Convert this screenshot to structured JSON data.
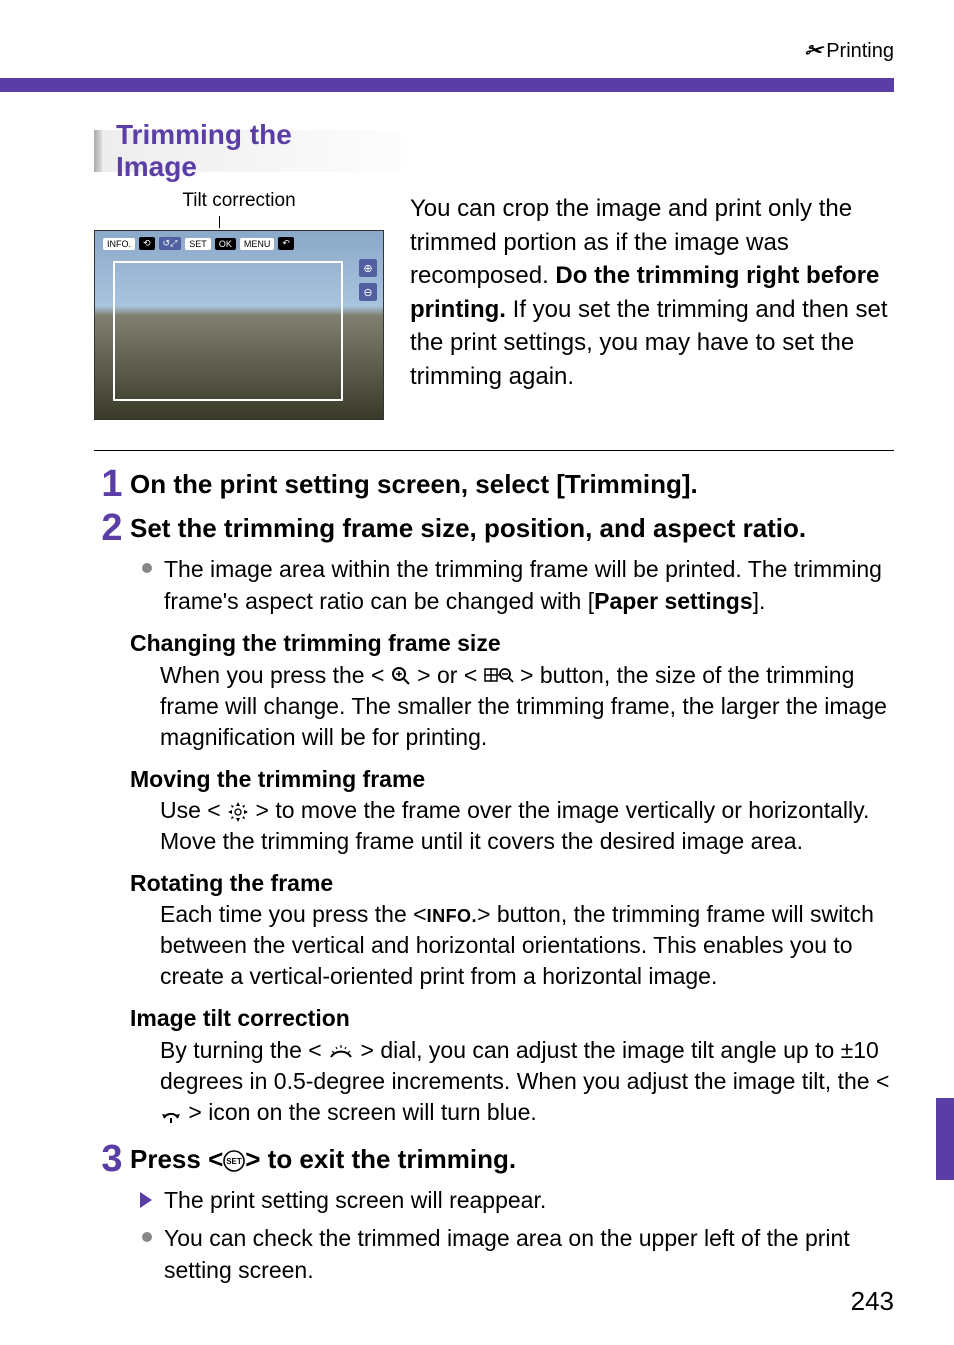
{
  "header": {
    "icon_name": "printer-icon",
    "label": "Printing"
  },
  "subheading": "Trimming the Image",
  "figure": {
    "tilt_label": "Tilt correction",
    "chips": [
      "INFO.",
      "⟲",
      "↺⤢",
      "SET",
      "OK",
      "MENU",
      "↶"
    ]
  },
  "intro": {
    "l1": "You can crop the image and print only the trimmed portion as if the image was recomposed. ",
    "bold1": "Do the trimming right before printing.",
    "l2": " If you set the trimming and then set the print settings, you may have to set the trimming again."
  },
  "steps": {
    "s1_title": "On the print setting screen, select [Trimming].",
    "s2_title": "Set the trimming frame size, position, and aspect ratio.",
    "s2_bullet_a": "The image area within the trimming frame will be printed. The trimming frame's aspect ratio can be changed with [",
    "s2_bullet_bold": "Paper settings",
    "s2_bullet_b": "].",
    "s2_h1": "Changing the trimming frame size",
    "s2_h1_body_a": "When you press the <",
    "s2_h1_body_b": "> or <",
    "s2_h1_body_c": "> button, the size of the trimming frame will change. The smaller the trimming frame, the larger the image magnification will be for printing.",
    "s2_h2": "Moving the trimming frame",
    "s2_h2_body_a": "Use <",
    "s2_h2_body_b": "> to move the frame over the image vertically or horizontally. Move the trimming frame until it covers the desired image area.",
    "s2_h3": "Rotating the frame",
    "s2_h3_body_a": "Each time you press the <",
    "s2_h3_info": "INFO.",
    "s2_h3_body_b": "> button, the trimming frame will switch between the vertical and horizontal orientations. This enables you to create a vertical-oriented print from a horizontal image.",
    "s2_h4": "Image tilt correction",
    "s2_h4_body_a": "By turning the <",
    "s2_h4_body_b": "> dial, you can adjust the image tilt angle up to ±10 degrees in 0.5-degree increments. When you adjust the image tilt, the <",
    "s2_h4_body_c": "> icon on the screen will turn blue.",
    "s3_title_a": "Press <",
    "s3_title_b": "> to exit the trimming.",
    "s3_tri": "The print setting screen will reappear.",
    "s3_bullet": "You can check the trimmed image area on the upper left of the print setting screen."
  },
  "page_number": "243"
}
